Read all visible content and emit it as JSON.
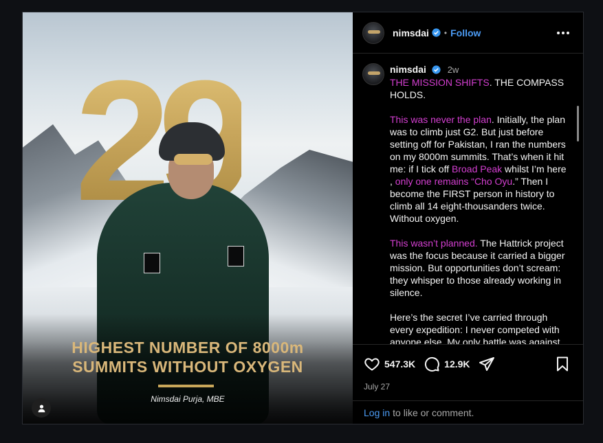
{
  "post": {
    "image": {
      "big_number": "29",
      "headline_line1": "HIGHEST NUMBER OF 8000m",
      "headline_line2": "SUMMITS WITHOUT OXYGEN",
      "credit_name": "Nimsdai Purja,",
      "credit_suffix": "MBE"
    }
  },
  "header": {
    "username": "nimsdai",
    "separator": "•",
    "follow_label": "Follow",
    "more_icon": "more-options-icon"
  },
  "caption": {
    "username": "nimsdai",
    "time": "2w",
    "p1_highlight": "THE MISSION SHIFTS",
    "p1_rest": ". THE COMPASS HOLDS.",
    "p2_highlight": "This was never the plan",
    "p2_a": ". Initially, the plan was to climb just G2. But just before setting off for Pakistan, I ran the numbers on my 8000m summits. That’s when it hit me: if I tick off ",
    "p2_hl2": "Broad Peak",
    "p2_b": " whilst I’m here , ",
    "p2_hl3": "only one remains “Cho Oyu",
    "p2_c": ".” Then I become the FIRST person in history to climb all 14 eight-thousanders twice. Without oxygen.",
    "p3_highlight": "This wasn’t planned.",
    "p3_rest": " The Hattrick project was the focus because it carried a bigger mission. But opportunities don’t scream: they whisper to those already working in silence.",
    "p4": "Here’s the secret I’ve carried through every expedition: I never competed with anyone else. My only battle was against"
  },
  "actions": {
    "likes": "547.3K",
    "comments": "12.9K",
    "date": "July 27"
  },
  "footer": {
    "login_link": "Log in",
    "login_rest": "to like or comment."
  },
  "colors": {
    "accent": "#4c9cf5",
    "highlight": "#d43fd1",
    "gold": "#c9a75a"
  }
}
